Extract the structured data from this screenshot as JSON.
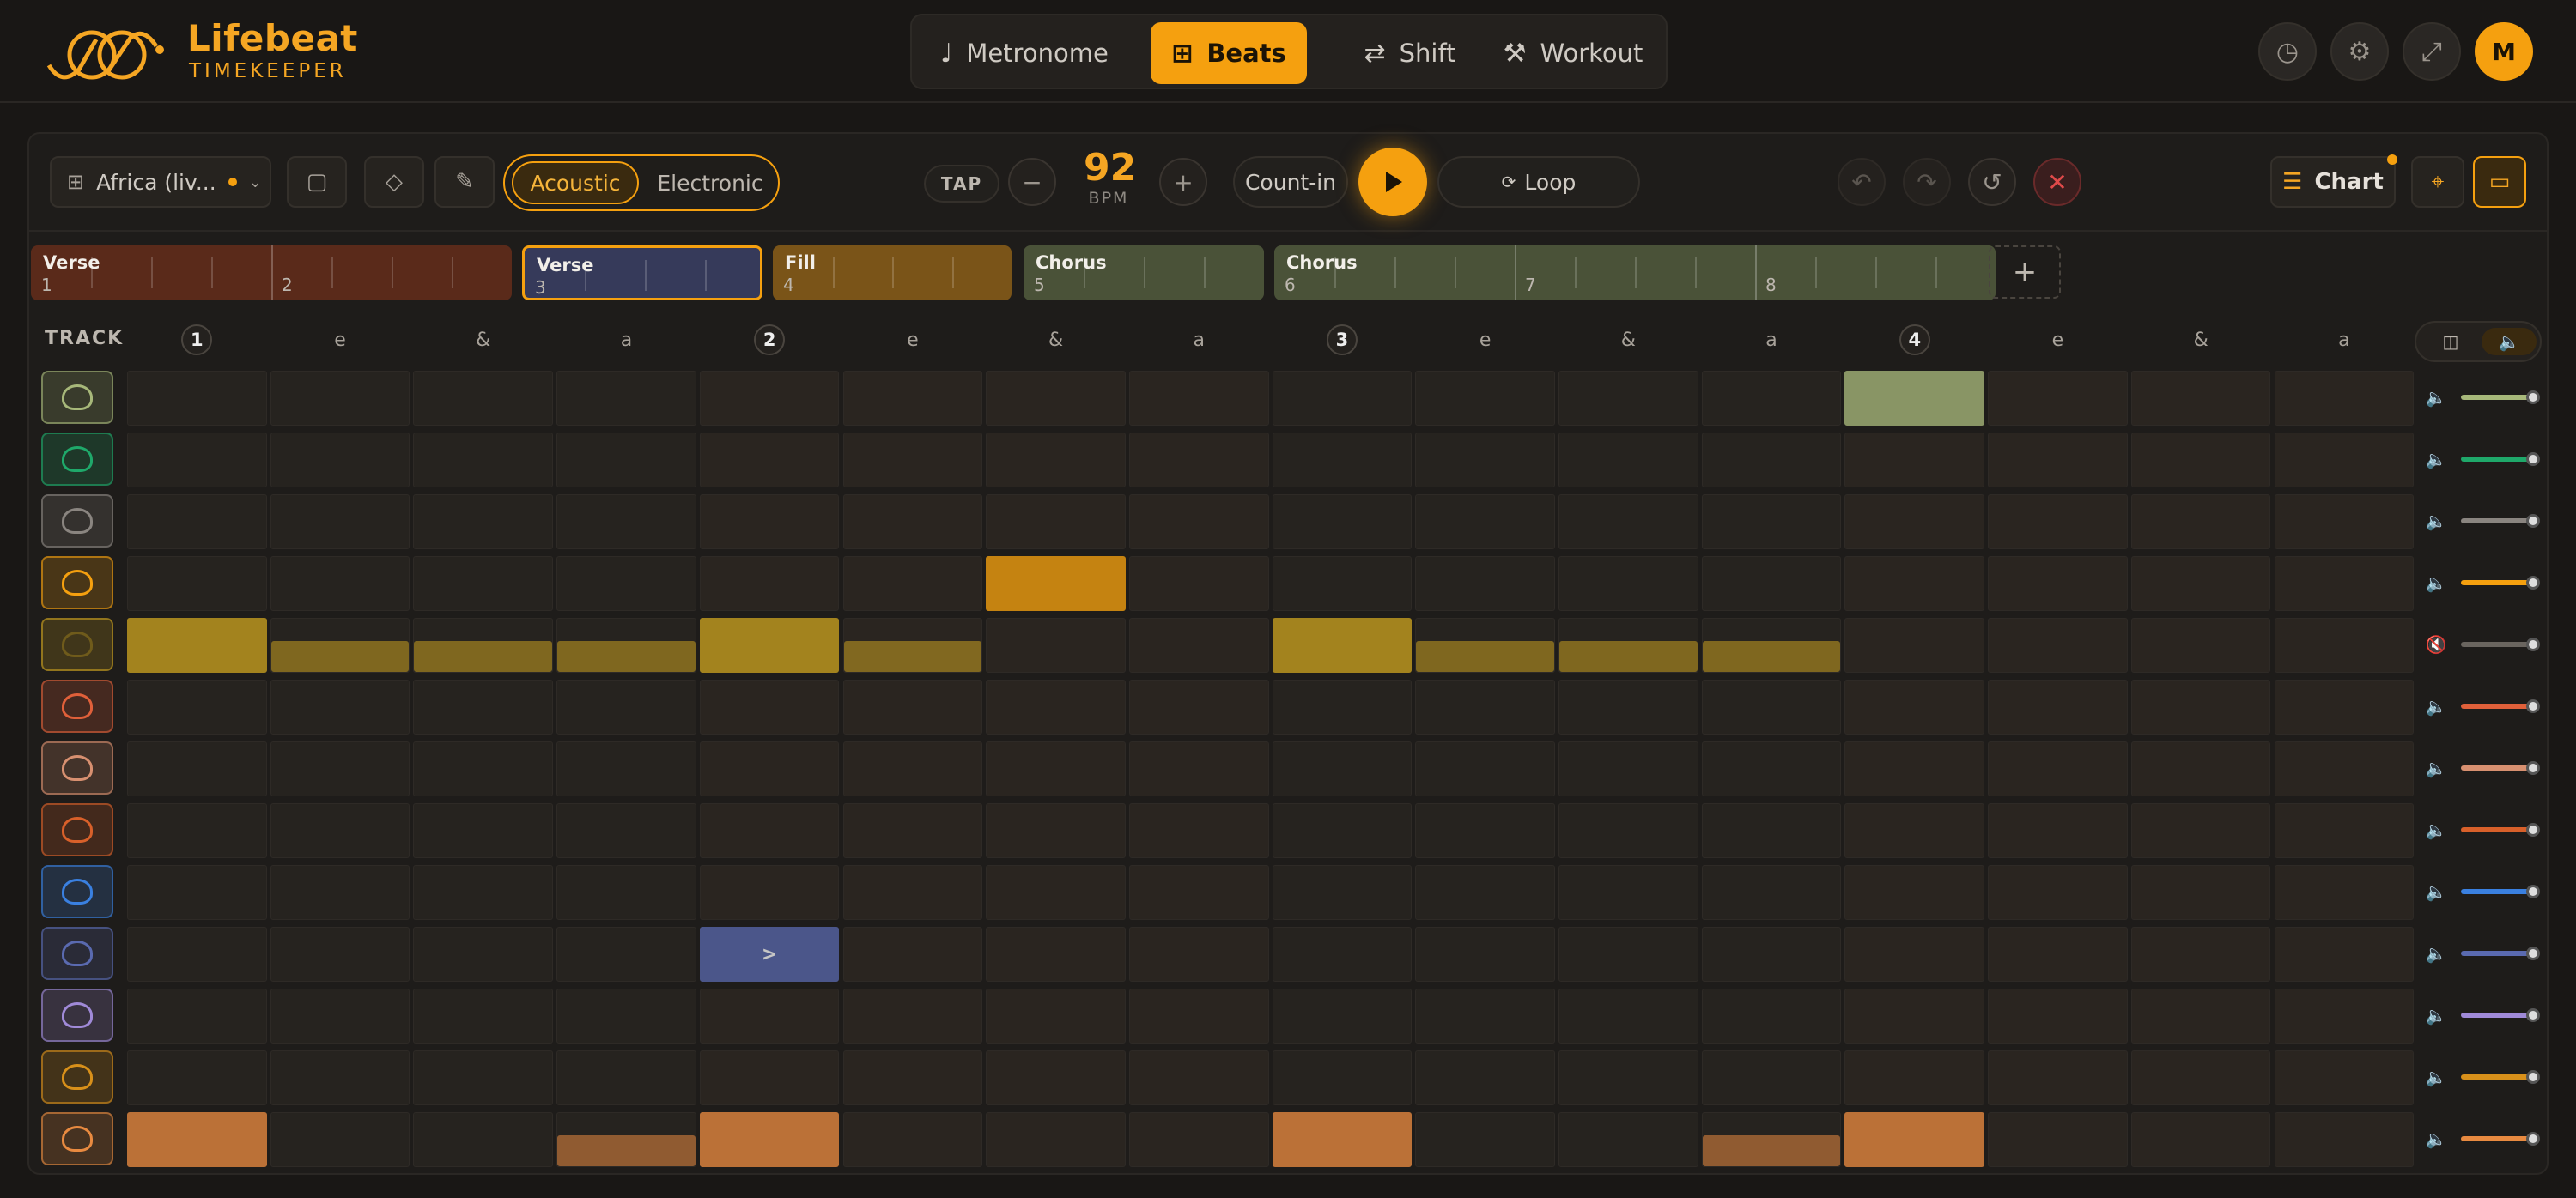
{
  "brand": {
    "name": "Lifebeat",
    "subtitle": "TIMEKEEPER"
  },
  "mode_tabs": [
    {
      "label": "Metronome",
      "icon": "note-icon",
      "active": false
    },
    {
      "label": "Beats",
      "icon": "grid-icon",
      "active": true
    },
    {
      "label": "Shift",
      "icon": "shift-arrows-icon",
      "active": false
    },
    {
      "label": "Workout",
      "icon": "dumbbell-icon",
      "active": false
    }
  ],
  "header_actions": [
    {
      "name": "history-icon",
      "glyph": "◷"
    },
    {
      "name": "gear-icon",
      "glyph": "⚙"
    },
    {
      "name": "fullscreen-icon",
      "glyph": "⤢"
    }
  ],
  "avatar_initial": "M",
  "toolbar": {
    "song_name": "Africa (liv...",
    "kit": {
      "options": [
        "Acoustic",
        "Electronic"
      ],
      "selected": "Acoustic"
    },
    "tap_label": "TAP",
    "bpm": "92",
    "bpm_label": "BPM",
    "minus": "−",
    "plus": "+",
    "count_in_label": "Count-in",
    "loop_label": "Loop",
    "chart_label": "Chart"
  },
  "sections": [
    {
      "name": "Verse",
      "bars": [
        "1",
        "2"
      ],
      "color": "#5a2a1a"
    },
    {
      "name": "Verse",
      "bars": [
        "3"
      ],
      "color": "#363a5a",
      "selected": true
    },
    {
      "name": "Fill",
      "bars": [
        "4"
      ],
      "color": "#7a5418"
    },
    {
      "name": "Chorus",
      "bars": [
        "5"
      ],
      "color": "#4a5238"
    },
    {
      "name": "Chorus",
      "bars": [
        "6",
        "7",
        "8"
      ],
      "color": "#4a5238"
    }
  ],
  "add_section_label": "+",
  "grid": {
    "track_label": "TRACK",
    "step_labels": [
      "1",
      "e",
      "&",
      "a",
      "2",
      "e",
      "&",
      "a",
      "3",
      "e",
      "&",
      "a",
      "4",
      "e",
      "&",
      "a"
    ],
    "tracks": [
      {
        "icon": "crash-cymbal-icon",
        "color": "#a7b87a",
        "steps": [
          0,
          0,
          0,
          0,
          0,
          0,
          0,
          0,
          0,
          0,
          0,
          0,
          3,
          0,
          0,
          0
        ]
      },
      {
        "icon": "china-cymbal-icon",
        "color": "#1fa86a",
        "steps": [
          0,
          0,
          0,
          0,
          0,
          0,
          0,
          0,
          0,
          0,
          0,
          0,
          0,
          0,
          0,
          0
        ]
      },
      {
        "icon": "cowbell-icon",
        "color": "#8a8580",
        "steps": [
          0,
          0,
          0,
          0,
          0,
          0,
          0,
          0,
          0,
          0,
          0,
          0,
          0,
          0,
          0,
          0
        ]
      },
      {
        "icon": "ride-cymbal-icon",
        "color": "#f5a00f",
        "steps": [
          0,
          0,
          0,
          0,
          0,
          0,
          3,
          0,
          0,
          0,
          0,
          0,
          0,
          0,
          0,
          0
        ]
      },
      {
        "icon": "hihat-icon",
        "color": "#c9a020",
        "muted": true,
        "steps": [
          3,
          1,
          1,
          1,
          3,
          1,
          0,
          0,
          3,
          1,
          1,
          1,
          0,
          0,
          0,
          0
        ]
      },
      {
        "icon": "tom-high-icon",
        "color": "#e0603a",
        "steps": [
          0,
          0,
          0,
          0,
          0,
          0,
          0,
          0,
          0,
          0,
          0,
          0,
          0,
          0,
          0,
          0
        ]
      },
      {
        "icon": "tom-mid-icon",
        "color": "#d89070",
        "steps": [
          0,
          0,
          0,
          0,
          0,
          0,
          0,
          0,
          0,
          0,
          0,
          0,
          0,
          0,
          0,
          0
        ]
      },
      {
        "icon": "floor-tom-icon",
        "color": "#d8602a",
        "steps": [
          0,
          0,
          0,
          0,
          0,
          0,
          0,
          0,
          0,
          0,
          0,
          0,
          0,
          0,
          0,
          0
        ]
      },
      {
        "icon": "snare-icon",
        "color": "#3a80e0",
        "steps": [
          0,
          0,
          0,
          0,
          0,
          0,
          0,
          0,
          0,
          0,
          0,
          0,
          0,
          0,
          0,
          0
        ]
      },
      {
        "icon": "snare-rim-icon",
        "color": "#5a6ab0",
        "steps": [
          0,
          0,
          0,
          0,
          4,
          0,
          0,
          0,
          0,
          0,
          0,
          0,
          0,
          0,
          0,
          0
        ]
      },
      {
        "icon": "clap-icon",
        "color": "#a08ad8",
        "steps": [
          0,
          0,
          0,
          0,
          0,
          0,
          0,
          0,
          0,
          0,
          0,
          0,
          0,
          0,
          0,
          0
        ]
      },
      {
        "icon": "hihat-pedal-icon",
        "color": "#d8901a",
        "steps": [
          0,
          0,
          0,
          0,
          0,
          0,
          0,
          0,
          0,
          0,
          0,
          0,
          0,
          0,
          0,
          0
        ]
      },
      {
        "icon": "kick-drum-icon",
        "color": "#e88a40",
        "steps": [
          3,
          0,
          0,
          1,
          3,
          0,
          0,
          0,
          3,
          0,
          0,
          1,
          3,
          0,
          0,
          0
        ]
      }
    ],
    "accent_mark": ">"
  }
}
